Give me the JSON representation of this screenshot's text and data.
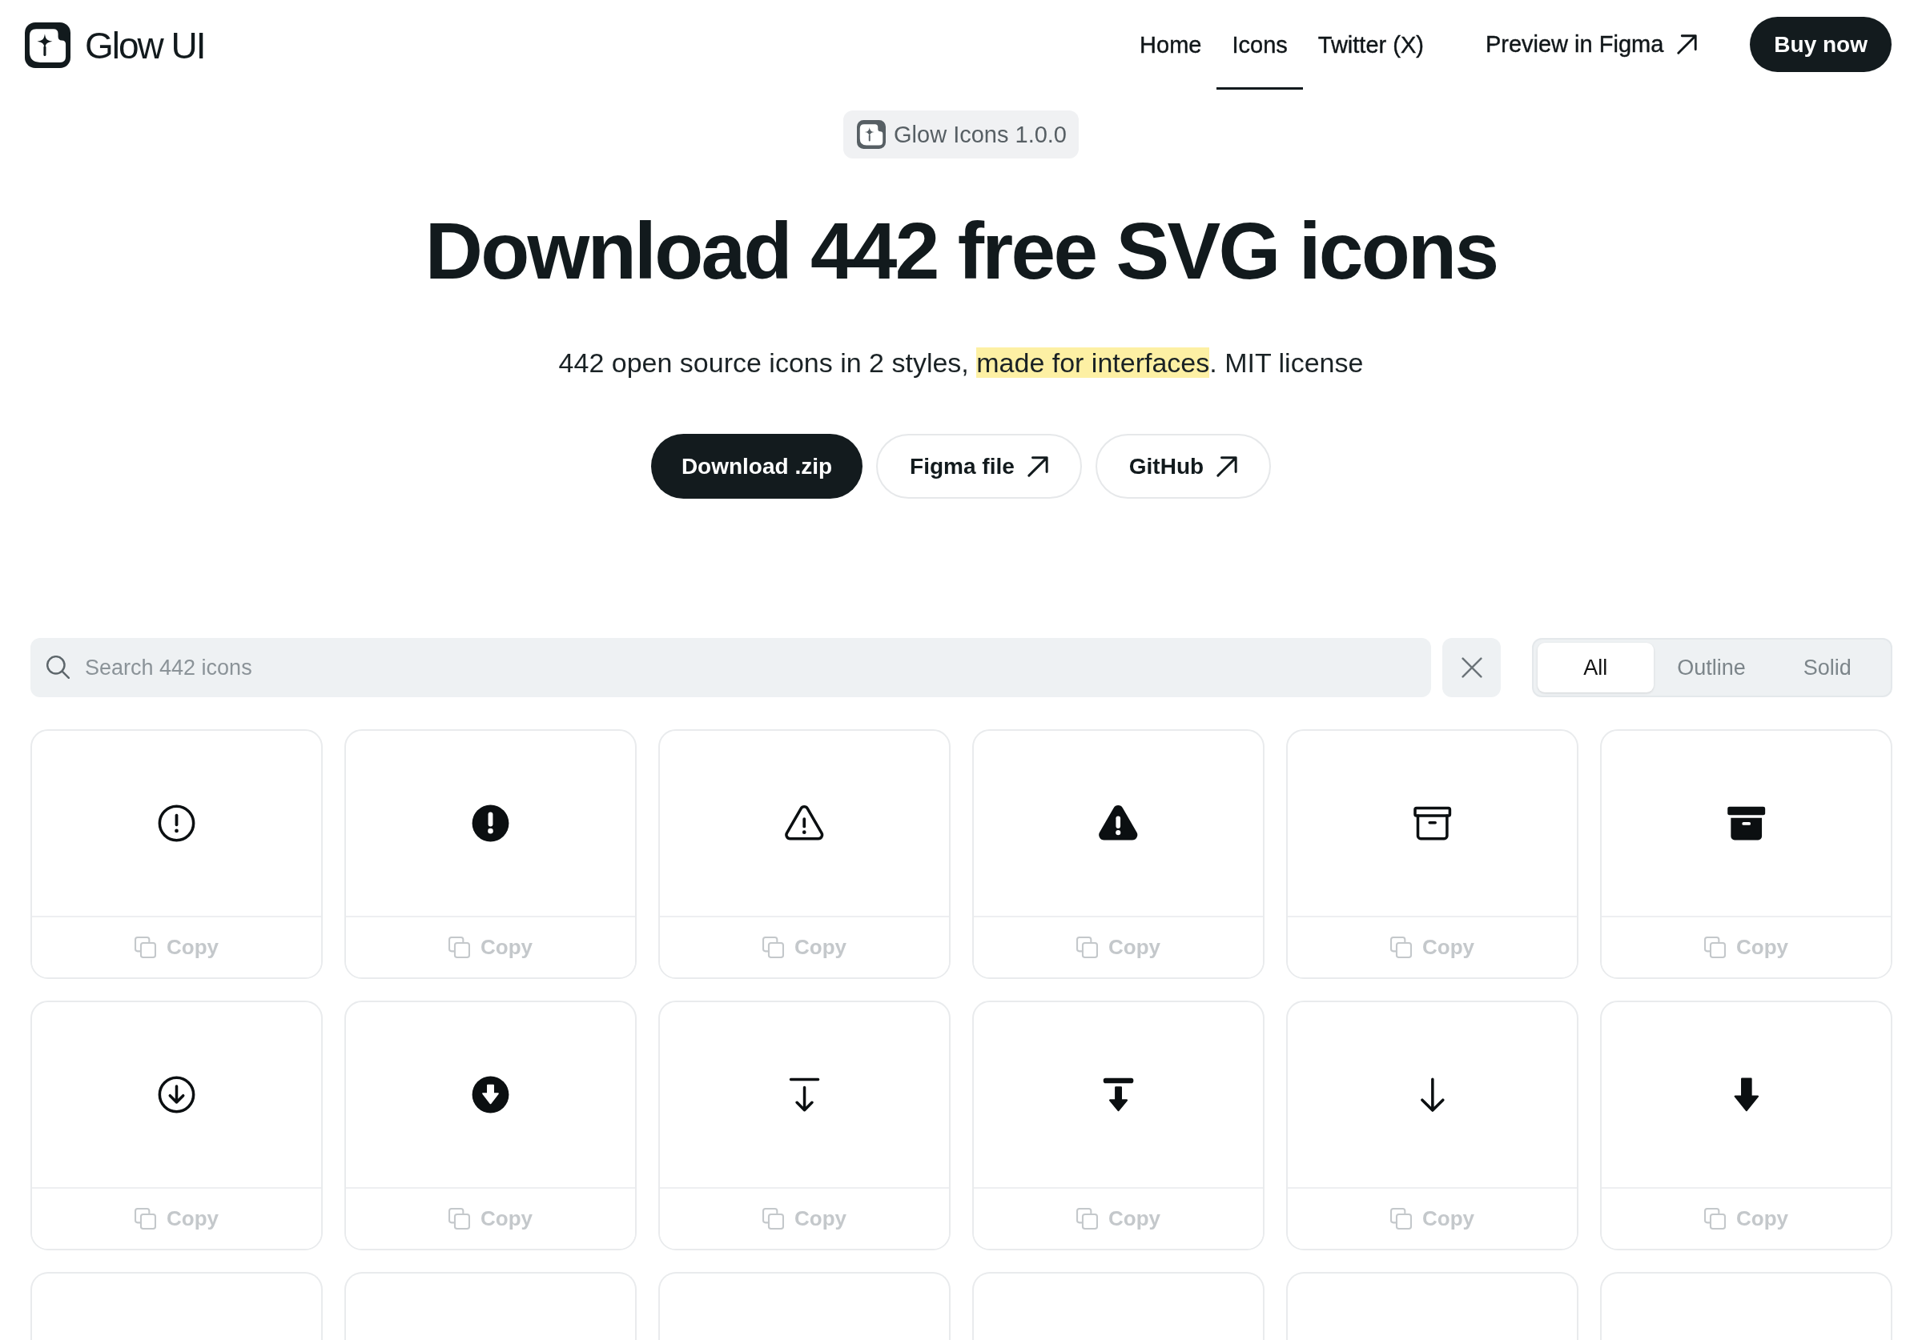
{
  "header": {
    "logo": "Glow UI",
    "nav": [
      {
        "label": "Home",
        "selected": false
      },
      {
        "label": "Icons",
        "selected": true
      },
      {
        "label": "Twitter (X)",
        "selected": false
      }
    ],
    "preview_link": "Preview in Figma",
    "buy_button": "Buy now"
  },
  "hero": {
    "badge": "Glow Icons 1.0.0",
    "title": "Download 442 free SVG icons",
    "subtitle": {
      "before": "442 open source icons in 2 styles, ",
      "highlight": "made for interfaces",
      "after": ". MIT license"
    },
    "buttons": [
      {
        "label": "Download .zip",
        "kind": "download"
      },
      {
        "label": "Figma file",
        "kind": "link"
      },
      {
        "label": "GitHub",
        "kind": "link"
      }
    ]
  },
  "toolbar": {
    "search": {
      "placeholder": "Search 442 icons"
    },
    "style_filter": [
      {
        "label": "All",
        "selected": true
      },
      {
        "label": "Outline",
        "selected": false
      },
      {
        "label": "Solid",
        "selected": false
      }
    ]
  },
  "icon_grid": [
    {
      "kind": "alert",
      "action": "Copy"
    },
    {
      "kind": "alertsolid",
      "action": "Copy"
    },
    {
      "kind": "warning",
      "action": "Copy"
    },
    {
      "kind": "warningsolid",
      "action": "Copy"
    },
    {
      "kind": "archive",
      "action": "Copy"
    },
    {
      "kind": "archivesolid",
      "action": "Copy"
    },
    {
      "kind": "download",
      "action": "Copy"
    },
    {
      "kind": "downloadsolid",
      "action": "Copy"
    },
    {
      "kind": "bararrow",
      "action": "Copy"
    },
    {
      "kind": "bararrowsolid",
      "action": "Copy"
    },
    {
      "kind": "arrow",
      "action": "Copy"
    },
    {
      "kind": "arrowsolid",
      "action": "Copy"
    },
    {
      "kind": "partial"
    },
    {
      "kind": "partial"
    },
    {
      "kind": "partial"
    },
    {
      "kind": "partial"
    },
    {
      "kind": "partial"
    },
    {
      "kind": "partial"
    }
  ]
}
